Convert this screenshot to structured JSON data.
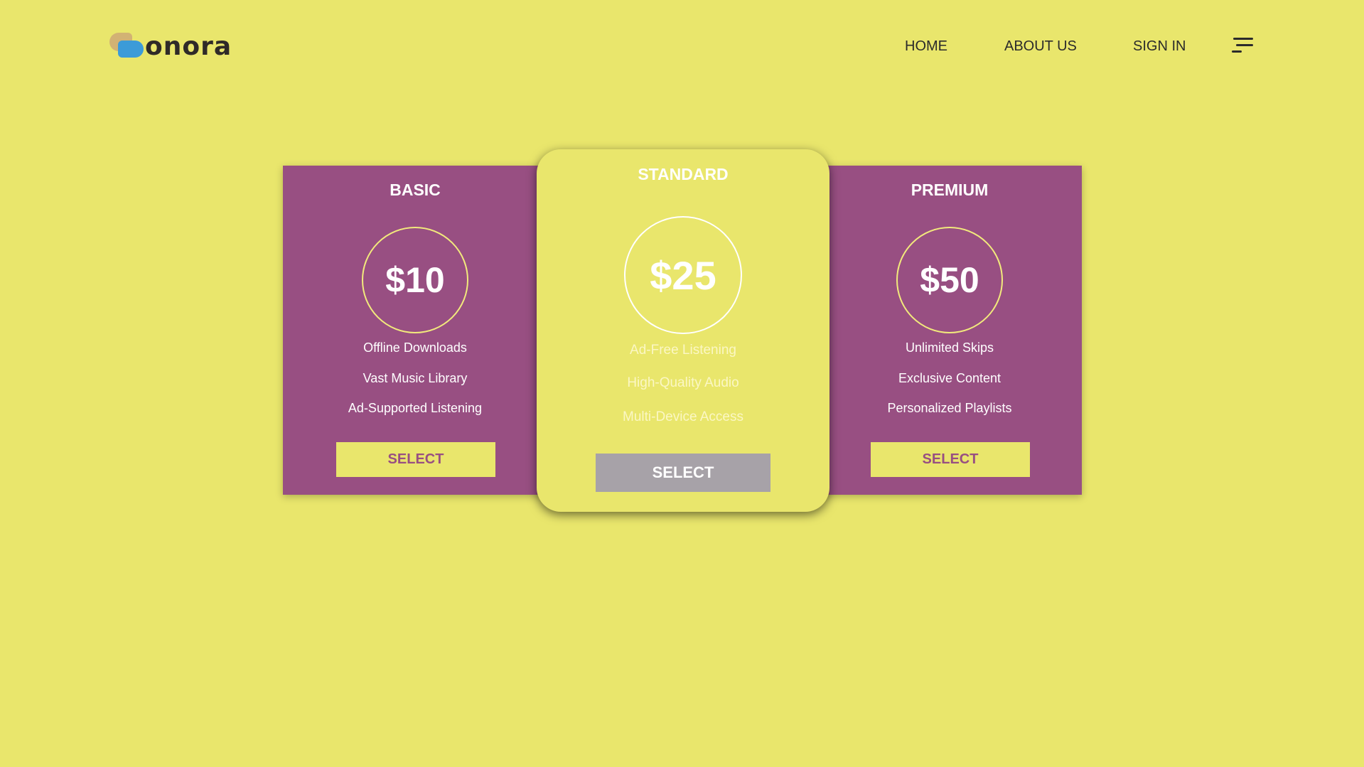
{
  "brand": {
    "name": "onora",
    "colors": {
      "background": "#e9e66c",
      "card": "#984f82",
      "logo_tan": "#d2b274",
      "logo_blue": "#3c9bd8",
      "featured_button": "#a7a2a8"
    }
  },
  "nav": {
    "home": "HOME",
    "about": "ABOUT US",
    "signin": "SIGN IN",
    "menu_icon": "hamburger-menu-icon"
  },
  "plans": [
    {
      "name": "BASIC",
      "price": "$10",
      "features": [
        "Offline Downloads",
        "Vast Music Library",
        "Ad-Supported Listening"
      ],
      "button": "SELECT"
    },
    {
      "name": "STANDARD",
      "price": "$25",
      "features": [
        "Ad-Free Listening",
        "High-Quality Audio",
        "Multi-Device Access"
      ],
      "button": "SELECT"
    },
    {
      "name": "PREMIUM",
      "price": "$50",
      "features": [
        "Unlimited Skips",
        "Exclusive Content",
        "Personalized Playlists"
      ],
      "button": "SELECT"
    }
  ]
}
